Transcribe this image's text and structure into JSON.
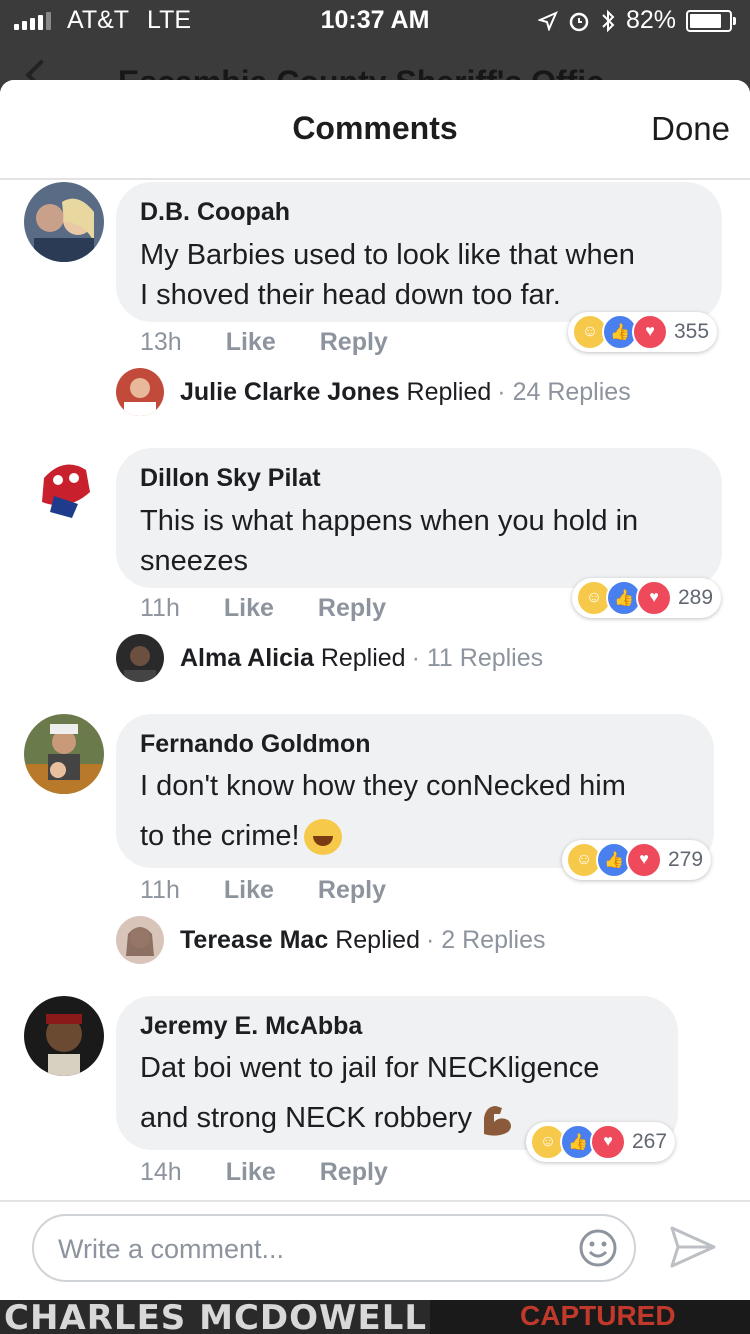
{
  "status_bar": {
    "carrier": "AT&T",
    "network": "LTE",
    "time": "10:37 AM",
    "battery": "82%",
    "battery_level": 0.82
  },
  "background_page": {
    "title": "Escambia County Sheriff's Offic"
  },
  "header": {
    "title": "Comments",
    "done_label": "Done"
  },
  "comments": [
    {
      "author": "D.B. Coopah",
      "lines": [
        "My Barbies used to look like that when",
        "I shoved their head down too far."
      ],
      "time": "13h",
      "like_label": "Like",
      "reply_label": "Reply",
      "reaction_count": "355",
      "replier": "Julie Clarke Jones",
      "replied_label": "Replied",
      "replies_count": "· 24 Replies"
    },
    {
      "author": "Dillon Sky Pilat",
      "lines": [
        "This is what happens when you hold in",
        "sneezes"
      ],
      "time": "11h",
      "like_label": "Like",
      "reply_label": "Reply",
      "reaction_count": "289",
      "replier": "Alma Alicia",
      "replied_label": "Replied",
      "replies_count": "· 11 Replies"
    },
    {
      "author": "Fernando Goldmon",
      "lines": [
        "I don't know how they conNecked him",
        "to the crime!"
      ],
      "time": "11h",
      "like_label": "Like",
      "reply_label": "Reply",
      "reaction_count": "279",
      "replier": "Terease Mac",
      "replied_label": "Replied",
      "replies_count": "· 2 Replies"
    },
    {
      "author": "Jeremy E. McAbba",
      "lines": [
        "Dat boi went to jail for NECKligence",
        "and strong NECK robbery"
      ],
      "time": "14h",
      "like_label": "Like",
      "reply_label": "Reply",
      "reaction_count": "267"
    }
  ],
  "composer": {
    "placeholder": "Write a comment..."
  },
  "banner": {
    "text": "CHARLES MCDOWELL",
    "stamp": "CAPTURED"
  },
  "colors": {
    "like_blue": "#4a7ff0",
    "love_red": "#ee4a5c",
    "haha_yellow": "#f7c94a",
    "muted_text": "#8d949e"
  }
}
